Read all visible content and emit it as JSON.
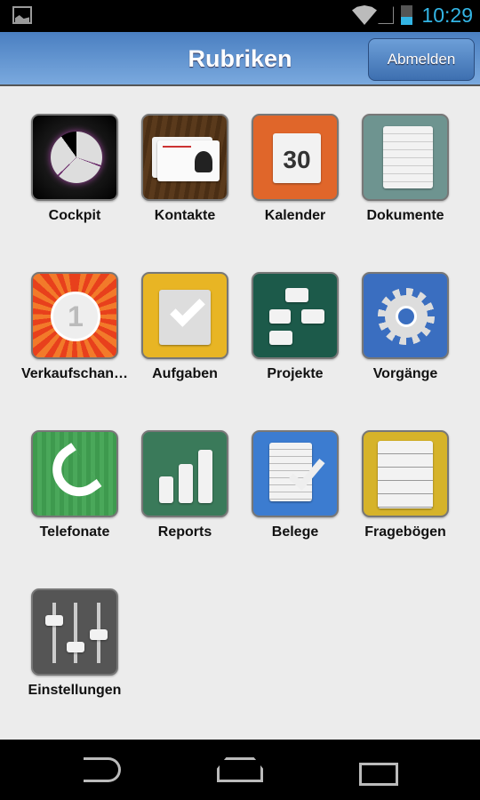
{
  "status_bar": {
    "time": "10:29",
    "battery_level": 0.4,
    "accent": "#33b5e5"
  },
  "header": {
    "title": "Rubriken",
    "logout_label": "Abmelden"
  },
  "tiles": [
    {
      "label": "Cockpit",
      "icon": "pie-chart-icon"
    },
    {
      "label": "Kontakte",
      "icon": "business-card-icon"
    },
    {
      "label": "Kalender",
      "icon": "calendar-icon",
      "icon_text": "30"
    },
    {
      "label": "Dokumente",
      "icon": "document-icon"
    },
    {
      "label": "Verkaufschan…",
      "icon": "medal-icon",
      "icon_text": "1"
    },
    {
      "label": "Aufgaben",
      "icon": "clipboard-check-icon"
    },
    {
      "label": "Projekte",
      "icon": "flowchart-icon"
    },
    {
      "label": "Vorgänge",
      "icon": "gear-icon"
    },
    {
      "label": "Telefonate",
      "icon": "phone-icon"
    },
    {
      "label": "Reports",
      "icon": "bar-chart-icon"
    },
    {
      "label": "Belege",
      "icon": "receipt-check-icon"
    },
    {
      "label": "Fragebögen",
      "icon": "checklist-icon"
    },
    {
      "label": "Einstellungen",
      "icon": "sliders-icon"
    }
  ],
  "nav": {
    "back": "back-icon",
    "home": "home-icon",
    "recent": "recent-apps-icon"
  }
}
